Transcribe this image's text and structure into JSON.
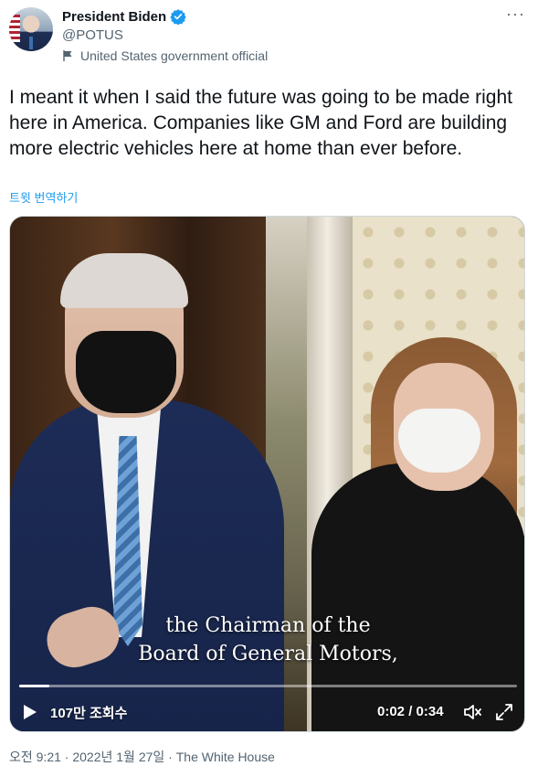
{
  "author": {
    "name": "President Biden",
    "handle": "@POTUS",
    "label": "United States government official"
  },
  "tweet": {
    "text": "I meant it when I said the future was going to be made right here in America. Companies like GM and Ford are building more electric vehicles here at home than ever before.",
    "translate_label": "트윗 번역하기"
  },
  "video": {
    "caption_line1": "the Chairman of the",
    "caption_line2": "Board of General Motors,",
    "views": "107만 조회수",
    "time": "0:02 / 0:34",
    "progress": 0.06
  },
  "meta": {
    "time": "오전 9:21",
    "separator": " · ",
    "date": "2022년 1월 27일",
    "source": "The White House"
  },
  "colors": {
    "verified": "#1d9bf0",
    "link": "#1d9bf0",
    "muted": "#536471"
  }
}
